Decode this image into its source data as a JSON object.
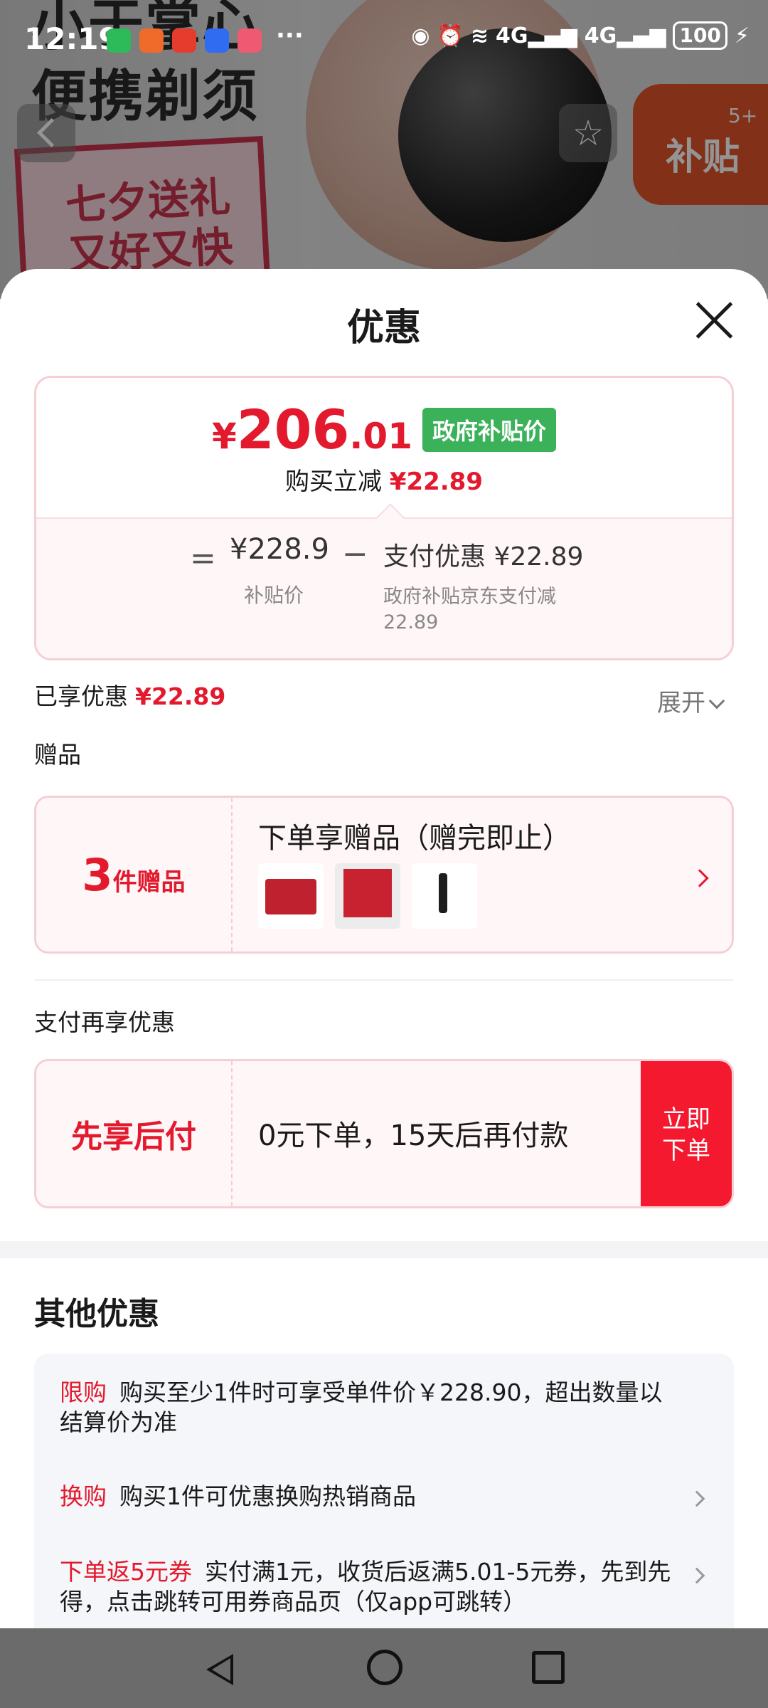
{
  "status_bar": {
    "time": "12:19",
    "more": "···",
    "battery": "100",
    "app_icon_colors": [
      "#2dbb5a",
      "#f06a2a",
      "#e63c2e",
      "#2f6cf2",
      "#ef5a72"
    ]
  },
  "background_page": {
    "slogan": "小于掌心\n便携剃须",
    "card_text": "七夕送礼\n又好又快",
    "share_badge": "补贴",
    "share_count": "5+"
  },
  "sheet": {
    "title": "优惠",
    "price": {
      "currency": "¥",
      "integer": "206",
      "decimal": ".01",
      "tag": "政府补贴价",
      "buy_label": "购买立减",
      "buy_amount": "¥22.89"
    },
    "breakdown": {
      "eq": "=",
      "subsidy_price": "¥228.9",
      "subsidy_label": "补贴价",
      "minus": "−",
      "pay_discount": "支付优惠 ¥22.89",
      "pay_desc": "政府补贴京东支付减22.89"
    },
    "enjoyed": {
      "label": "已享优惠",
      "amount": "¥22.89",
      "expand": "展开"
    },
    "gifts": {
      "section": "赠品",
      "count": "3",
      "count_suffix": "件赠品",
      "title": "下单享赠品（赠完即止）"
    },
    "payment": {
      "section": "支付再享优惠",
      "name": "先享后付",
      "desc": "0元下单，15天后再付款",
      "button": "立即\n下单"
    },
    "other": {
      "title": "其他优惠",
      "rows": [
        {
          "tag": "限购",
          "text": "购买至少1件时可享受单件价￥228.90，超出数量以结算价为准"
        },
        {
          "tag": "换购",
          "text": "购买1件可优惠换购热销商品"
        },
        {
          "tag": "下单返5元券",
          "text": "实付满1元，收货后返满5.01-5元券，先到先得，点击跳转可用券商品页（仅app可跳转）"
        }
      ]
    }
  },
  "colors": {
    "accent_red": "#e3192d",
    "gov_green": "#3bb15a",
    "pink_border": "#f6cfd5"
  }
}
